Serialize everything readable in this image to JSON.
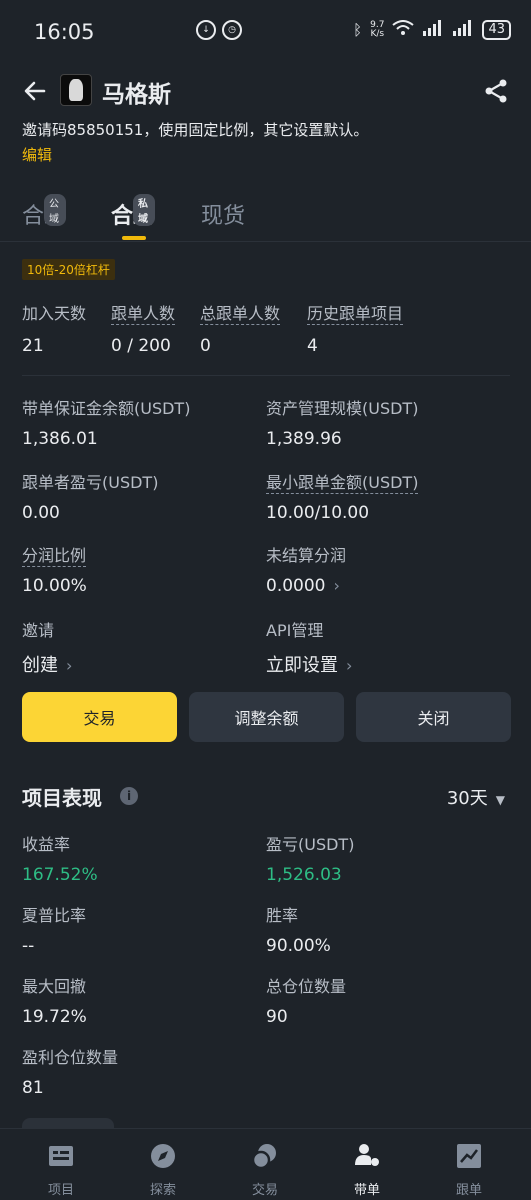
{
  "status": {
    "time": "16:05",
    "speed": "9.7",
    "speed_unit": "K/s",
    "battery": "43"
  },
  "header": {
    "title": "马格斯"
  },
  "description": "邀请码85850151，使用固定比例，其它设置默认。",
  "edit_label": "编辑",
  "tabs": [
    {
      "label": "合约",
      "badge": "公域"
    },
    {
      "label": "合约",
      "badge": "私域"
    },
    {
      "label": "现货"
    }
  ],
  "leverage_tag": "10倍-20倍杠杆",
  "stats": [
    {
      "label": "加入天数",
      "value": "21"
    },
    {
      "label": "跟单人数",
      "value": "0 / 200"
    },
    {
      "label": "总跟单人数",
      "value": "0"
    },
    {
      "label": "历史跟单项目",
      "value": "4"
    }
  ],
  "details": {
    "margin_balance": {
      "label": "带单保证金余额(USDT)",
      "value": "1,386.01"
    },
    "aum": {
      "label": "资产管理规模(USDT)",
      "value": "1,389.96"
    },
    "follower_pnl": {
      "label": "跟单者盈亏(USDT)",
      "value": "0.00"
    },
    "min_amount": {
      "label": "最小跟单金额(USDT)",
      "value": "10.00/10.00"
    },
    "profit_share": {
      "label": "分润比例",
      "value": "10.00%"
    },
    "unsettled": {
      "label": "未结算分润",
      "value": "0.0000"
    },
    "invite": {
      "label": "邀请",
      "value": "创建"
    },
    "api": {
      "label": "API管理",
      "value": "立即设置"
    }
  },
  "buttons": {
    "trade": "交易",
    "adjust": "调整余额",
    "close": "关闭"
  },
  "performance": {
    "title": "项目表现",
    "period": "30天",
    "roi": {
      "label": "收益率",
      "value": "167.52%"
    },
    "pnl": {
      "label": "盈亏(USDT)",
      "value": "1,526.03"
    },
    "sharpe": {
      "label": "夏普比率",
      "value": "--"
    },
    "win_rate": {
      "label": "胜率",
      "value": "90.00%"
    },
    "max_drawdown": {
      "label": "最大回撤",
      "value": "19.72%"
    },
    "total_positions": {
      "label": "总仓位数量",
      "value": "90"
    },
    "profit_positions": {
      "label": "盈利仓位数量",
      "value": "81"
    }
  },
  "nav": [
    {
      "label": "项目",
      "icon": "list-icon"
    },
    {
      "label": "探索",
      "icon": "compass-icon"
    },
    {
      "label": "交易",
      "icon": "trade-icon"
    },
    {
      "label": "带单",
      "icon": "lead-icon"
    },
    {
      "label": "跟单",
      "icon": "chart-icon"
    }
  ],
  "colors": {
    "accent": "#f0b90b",
    "primary_button": "#fcd535",
    "positive": "#2ebd85",
    "background": "#1e2329"
  }
}
